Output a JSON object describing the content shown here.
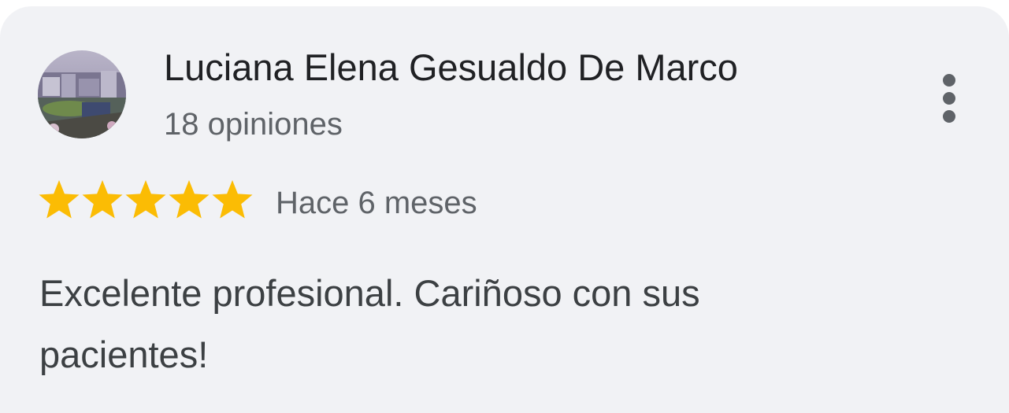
{
  "review": {
    "reviewer_name": "Luciana Elena Gesualdo De Marco",
    "review_count": "18 opiniones",
    "rating": 5,
    "max_rating": 5,
    "date": "Hace 6 meses",
    "text": "Excelente profesional. Cariñoso con sus pacientes!"
  },
  "icons": {
    "avatar": "reviewer-photo-avatar",
    "menu": "more-vert-icon",
    "star": "star-icon"
  },
  "colors": {
    "card_background": "#f1f2f5",
    "star_filled": "#fbbc04",
    "star_empty": "#dadce0",
    "primary_text": "#202124",
    "secondary_text": "#5f6368"
  }
}
